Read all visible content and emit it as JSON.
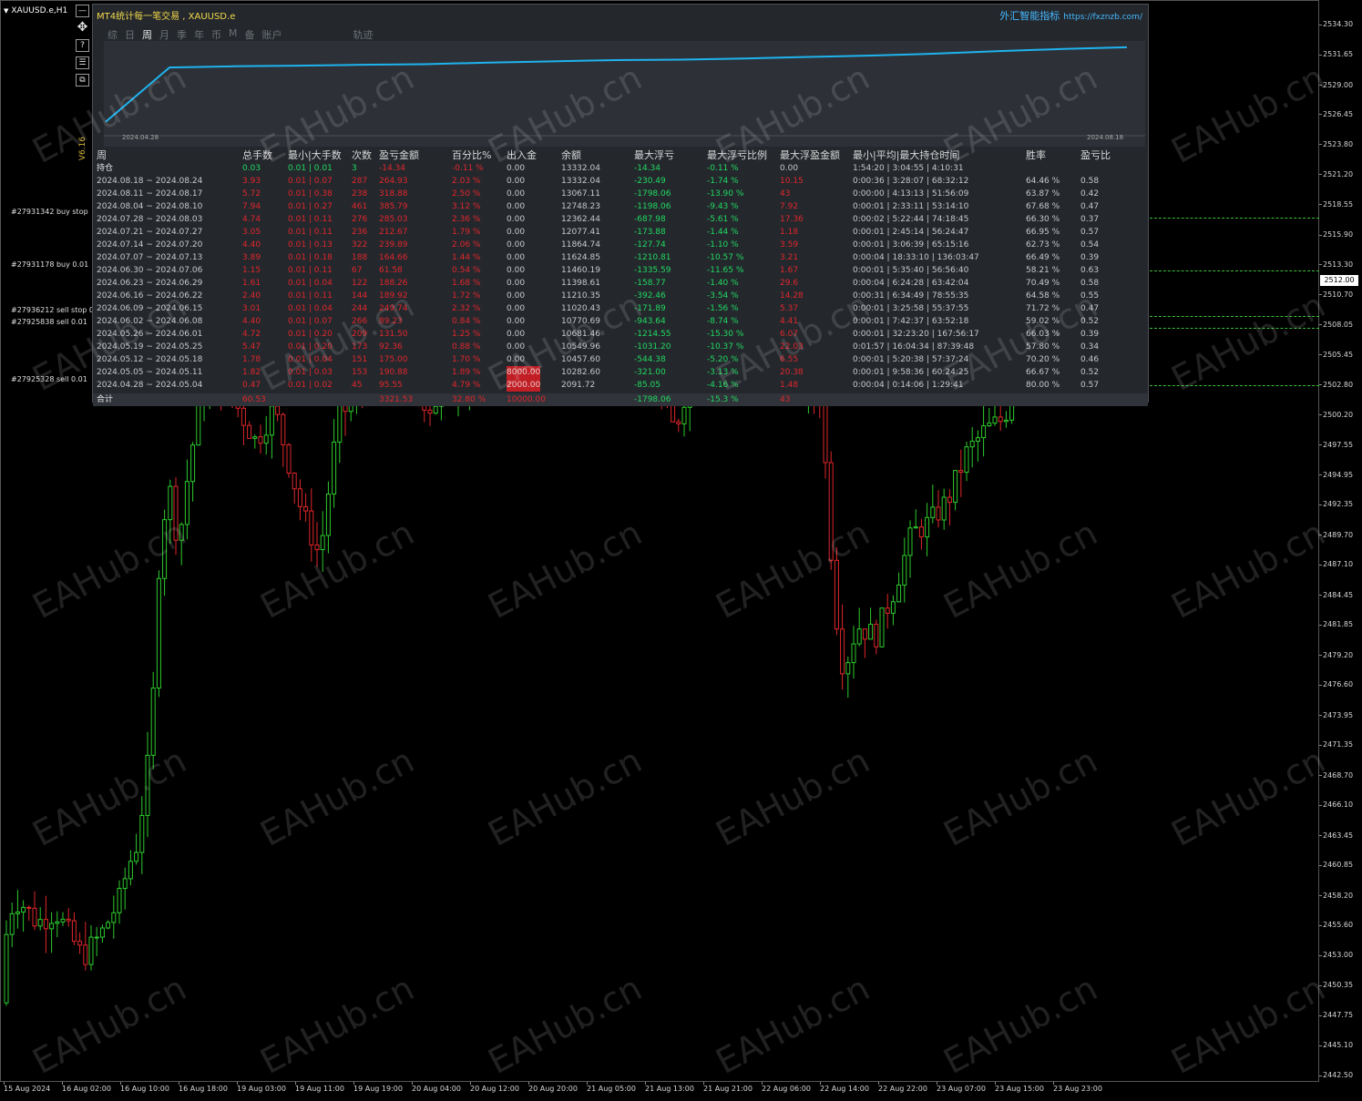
{
  "chart": {
    "symbol": "XAUUSD.e,H1",
    "price_ticks": [
      "2534.30",
      "2531.65",
      "2529.00",
      "2526.45",
      "2523.80",
      "2521.20",
      "2518.55",
      "2515.90",
      "2513.30",
      "2510.70",
      "2508.05",
      "2505.45",
      "2502.80",
      "2500.20",
      "2497.55",
      "2494.95",
      "2492.35",
      "2489.70",
      "2487.10",
      "2484.45",
      "2481.85",
      "2479.20",
      "2476.60",
      "2473.95",
      "2471.35",
      "2468.70",
      "2466.10",
      "2463.45",
      "2460.85",
      "2458.20",
      "2455.60",
      "2453.00",
      "2450.35",
      "2447.75",
      "2445.10",
      "2442.50"
    ],
    "current_price": "2512.00",
    "time_ticks": [
      "15 Aug 2024",
      "16 Aug 02:00",
      "16 Aug 10:00",
      "16 Aug 18:00",
      "19 Aug 03:00",
      "19 Aug 11:00",
      "19 Aug 19:00",
      "20 Aug 04:00",
      "20 Aug 12:00",
      "20 Aug 20:00",
      "21 Aug 05:00",
      "21 Aug 13:00",
      "21 Aug 21:00",
      "22 Aug 06:00",
      "22 Aug 14:00",
      "22 Aug 22:00",
      "23 Aug 07:00",
      "23 Aug 15:00",
      "23 Aug 23:00"
    ],
    "orders": [
      {
        "label": "#27931342 buy stop",
        "price": 2517.5
      },
      {
        "label": "#27931178 buy 0.01",
        "price": 2512.9
      },
      {
        "label": "#27936212 sell stop 0",
        "price": 2508.9
      },
      {
        "label": "#27925838 sell 0.01",
        "price": 2507.9
      },
      {
        "label": "#27925328 sell 0.01",
        "price": 2502.9
      }
    ],
    "colors": {
      "up": "#2ccc2c",
      "down": "#e0262b",
      "order_line": "#3bbf3b"
    }
  },
  "tools": {
    "move_icon": "✥",
    "help": "?",
    "grid_icon": "☰",
    "restore_icon": "⧉",
    "minimize": "—"
  },
  "version": "V6.16",
  "panel": {
    "title": "MT4统计每一笔交易 , XAUUSD.e",
    "brand": "外汇智能指标",
    "brand_url": "https://fxznzb.com/",
    "tabs": [
      "综",
      "日",
      "周",
      "月",
      "季",
      "年",
      "币",
      "M",
      "备",
      "账户",
      "轨迹"
    ],
    "active_tab": "周",
    "equity_start": "2024.04.28",
    "equity_end": "2024.08.18",
    "equity_values": [
      2091.72,
      10282.6,
      10457.6,
      10549.96,
      10681.46,
      10770.69,
      11020.43,
      11210.35,
      11398.61,
      11460.19,
      11624.85,
      11864.74,
      12077.41,
      12362.44,
      12748.23,
      13067.11,
      13332.04
    ],
    "colors": {
      "line": "#1fb3ee",
      "profit": "#21d860",
      "loss": "#e0262b",
      "accent": "#f1d84a"
    }
  },
  "table": {
    "headers": [
      "周",
      "总手数",
      "最小|大手数",
      "次数",
      "盈亏金额",
      "百分比%",
      "出入金",
      "余额",
      "最大浮亏",
      "最大浮亏比例",
      "最大浮盈金额",
      "最小|平均|最大持仓时间",
      "胜率",
      "盈亏比"
    ],
    "position": [
      "持仓",
      "0.03",
      "0.01 | 0.01",
      "3",
      "-14.34",
      "-0.11 %",
      "0.00",
      "13332.04",
      "-14.34",
      "-0.11 %",
      "0.00",
      "1:54:20 | 3:04:55 | 4:10:31",
      "",
      ""
    ],
    "rows": [
      [
        "2024.08.18 ~ 2024.08.24",
        "3.93",
        "0.01 | 0.07",
        "287",
        "264.93",
        "2.03 %",
        "0.00",
        "13332.04",
        "-230.49",
        "-1.74 %",
        "10.15",
        "0:00:36 | 3:28:07 | 68:32:12",
        "64.46 %",
        "0.58"
      ],
      [
        "2024.08.11 ~ 2024.08.17",
        "5.72",
        "0.01 | 0.38",
        "238",
        "318.88",
        "2.50 %",
        "0.00",
        "13067.11",
        "-1798.06",
        "-13.90 %",
        "43",
        "0:00:00 | 4:13:13 | 51:56:09",
        "63.87 %",
        "0.42"
      ],
      [
        "2024.08.04 ~ 2024.08.10",
        "7.94",
        "0.01 | 0.27",
        "461",
        "385.79",
        "3.12 %",
        "0.00",
        "12748.23",
        "-1198.06",
        "-9.43 %",
        "7.92",
        "0:00:01 | 2:33:11 | 53:14:10",
        "67.68 %",
        "0.47"
      ],
      [
        "2024.07.28 ~ 2024.08.03",
        "4.74",
        "0.01 | 0.11",
        "276",
        "285.03",
        "2.36 %",
        "0.00",
        "12362.44",
        "-687.98",
        "-5.61 %",
        "17.36",
        "0:00:02 | 5:22:44 | 74:18:45",
        "66.30 %",
        "0.37"
      ],
      [
        "2024.07.21 ~ 2024.07.27",
        "3.05",
        "0.01 | 0.11",
        "236",
        "212.67",
        "1.79 %",
        "0.00",
        "12077.41",
        "-173.88",
        "-1.44 %",
        "1.18",
        "0:00:01 | 2:45:14 | 56:24:47",
        "66.95 %",
        "0.57"
      ],
      [
        "2024.07.14 ~ 2024.07.20",
        "4.40",
        "0.01 | 0.13",
        "322",
        "239.89",
        "2.06 %",
        "0.00",
        "11864.74",
        "-127.74",
        "-1.10 %",
        "3.59",
        "0:00:01 | 3:06:39 | 65:15:16",
        "62.73 %",
        "0.54"
      ],
      [
        "2024.07.07 ~ 2024.07.13",
        "3.89",
        "0.01 | 0.18",
        "188",
        "164.66",
        "1.44 %",
        "0.00",
        "11624.85",
        "-1210.81",
        "-10.57 %",
        "3.21",
        "0:00:04 | 18:33:10 | 136:03:47",
        "66.49 %",
        "0.39"
      ],
      [
        "2024.06.30 ~ 2024.07.06",
        "1.15",
        "0.01 | 0.11",
        "67",
        "61.58",
        "0.54 %",
        "0.00",
        "11460.19",
        "-1335.59",
        "-11.65 %",
        "1.67",
        "0:00:01 | 5:35:40 | 56:56:40",
        "58.21 %",
        "0.63"
      ],
      [
        "2024.06.23 ~ 2024.06.29",
        "1.61",
        "0.01 | 0.04",
        "122",
        "188.26",
        "1.68 %",
        "0.00",
        "11398.61",
        "-158.77",
        "-1.40 %",
        "29.6",
        "0:00:04 | 6:24:28 | 63:42:04",
        "70.49 %",
        "0.58"
      ],
      [
        "2024.06.16 ~ 2024.06.22",
        "2.40",
        "0.01 | 0.11",
        "144",
        "189.92",
        "1.72 %",
        "0.00",
        "11210.35",
        "-392.46",
        "-3.54 %",
        "14.28",
        "0:00:31 | 6:34:49 | 78:55:35",
        "64.58 %",
        "0.55"
      ],
      [
        "2024.06.09 ~ 2024.06.15",
        "3.01",
        "0.01 | 0.04",
        "244",
        "249.74",
        "2.32 %",
        "0.00",
        "11020.43",
        "-171.89",
        "-1.56 %",
        "5.37",
        "0:00:01 | 3:25:58 | 55:37:55",
        "71.72 %",
        "0.47"
      ],
      [
        "2024.06.02 ~ 2024.06.08",
        "4.40",
        "0.01 | 0.07",
        "266",
        "89.23",
        "0.84 %",
        "0.00",
        "10770.69",
        "-943.64",
        "-8.74 %",
        "4.41",
        "0:00:01 | 7:42:37 | 63:52:18",
        "59.02 %",
        "0.52"
      ],
      [
        "2024.05.26 ~ 2024.06.01",
        "4.72",
        "0.01 | 0.20",
        "209",
        "131.50",
        "1.25 %",
        "0.00",
        "10681.46",
        "-1214.55",
        "-15.30 %",
        "6.07",
        "0:00:01 | 32:23:20 | 167:56:17",
        "66.03 %",
        "0.39"
      ],
      [
        "2024.05.19 ~ 2024.05.25",
        "5.47",
        "0.01 | 0.20",
        "173",
        "92.36",
        "0.88 %",
        "0.00",
        "10549.96",
        "-1031.20",
        "-10.37 %",
        "22.03",
        "0:01:57 | 16:04:34 | 87:39:48",
        "57.80 %",
        "0.34"
      ],
      [
        "2024.05.12 ~ 2024.05.18",
        "1.78",
        "0.01 | 0.04",
        "151",
        "175.00",
        "1.70 %",
        "0.00",
        "10457.60",
        "-544.38",
        "-5.20 %",
        "6.55",
        "0:00:01 | 5:20:38 | 57:37:24",
        "70.20 %",
        "0.46"
      ],
      [
        "2024.05.05 ~ 2024.05.11",
        "1.82",
        "0.01 | 0.03",
        "153",
        "190.88",
        "1.89 %",
        "8000.00",
        "10282.60",
        "-321.00",
        "-3.13 %",
        "20.38",
        "0:00:01 | 9:58:36 | 60:24:25",
        "66.67 %",
        "0.52"
      ],
      [
        "2024.04.28 ~ 2024.05.04",
        "0.47",
        "0.01 | 0.02",
        "45",
        "95.55",
        "4.79 %",
        "2000.00",
        "2091.72",
        "-85.05",
        "-4.16 %",
        "1.48",
        "0:00:04 | 0:14:06 | 1:29:41",
        "80.00 %",
        "0.57"
      ]
    ],
    "total": [
      "合计",
      "60.53",
      "",
      "",
      "3321.53",
      "32.80 %",
      "10000.00",
      "",
      "-1798.06",
      "-15.3 %",
      "43",
      "",
      "",
      ""
    ]
  },
  "watermark": "EAHub.cn"
}
